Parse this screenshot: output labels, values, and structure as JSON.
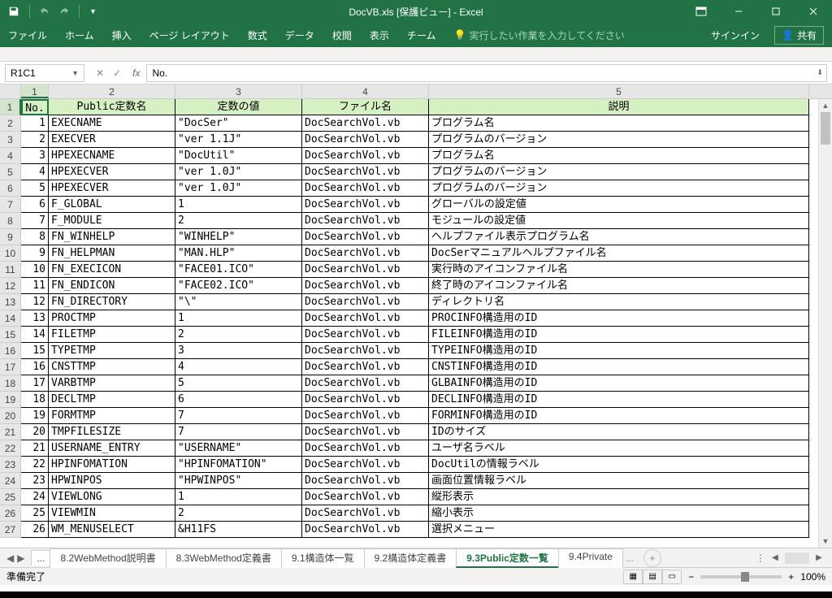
{
  "window": {
    "title": "DocVB.xls [保護ビュー] - Excel"
  },
  "ribbon": {
    "tabs": [
      "ファイル",
      "ホーム",
      "挿入",
      "ページ レイアウト",
      "数式",
      "データ",
      "校閲",
      "表示",
      "チーム"
    ],
    "tell_me": "実行したい作業を入力してください",
    "sign_in": "サインイン",
    "share": "共有"
  },
  "formula_bar": {
    "name_box": "R1C1",
    "formula": "No."
  },
  "columns": [
    "1",
    "2",
    "3",
    "4",
    "5"
  ],
  "header_row": [
    "No.",
    "Public定数名",
    "定数の値",
    "ファイル名",
    "説明"
  ],
  "rows": [
    {
      "no": "1",
      "name": "EXECNAME",
      "val": "\"DocSer\"",
      "file": "DocSearchVol.vb",
      "desc": "プログラム名"
    },
    {
      "no": "2",
      "name": "EXECVER",
      "val": "\"ver 1.1J\"",
      "file": "DocSearchVol.vb",
      "desc": "プログラムのバージョン"
    },
    {
      "no": "3",
      "name": "HPEXECNAME",
      "val": "\"DocUtil\"",
      "file": "DocSearchVol.vb",
      "desc": "プログラム名"
    },
    {
      "no": "4",
      "name": "HPEXECVER",
      "val": "\"ver 1.0J\"",
      "file": "DocSearchVol.vb",
      "desc": "プログラムのバージョン"
    },
    {
      "no": "5",
      "name": "HPEXECVER",
      "val": "\"ver 1.0J\"",
      "file": "DocSearchVol.vb",
      "desc": "プログラムのバージョン"
    },
    {
      "no": "6",
      "name": "F_GLOBAL",
      "val": "1",
      "file": "DocSearchVol.vb",
      "desc": "グローバルの設定値"
    },
    {
      "no": "7",
      "name": "F_MODULE",
      "val": "2",
      "file": "DocSearchVol.vb",
      "desc": "モジュールの設定値"
    },
    {
      "no": "8",
      "name": "FN_WINHELP",
      "val": "\"WINHELP\"",
      "file": "DocSearchVol.vb",
      "desc": "ヘルプファイル表示プログラム名"
    },
    {
      "no": "9",
      "name": "FN_HELPMAN",
      "val": "\"MAN.HLP\"",
      "file": "DocSearchVol.vb",
      "desc": "DocSerマニュアルヘルプファイル名"
    },
    {
      "no": "10",
      "name": "FN_EXECICON",
      "val": "\"FACE01.ICO\"",
      "file": "DocSearchVol.vb",
      "desc": "実行時のアイコンファイル名"
    },
    {
      "no": "11",
      "name": "FN_ENDICON",
      "val": "\"FACE02.ICO\"",
      "file": "DocSearchVol.vb",
      "desc": "終了時のアイコンファイル名"
    },
    {
      "no": "12",
      "name": "FN_DIRECTORY",
      "val": "\"\\\"",
      "file": "DocSearchVol.vb",
      "desc": "ディレクトリ名"
    },
    {
      "no": "13",
      "name": "PROCTMP",
      "val": "1",
      "file": "DocSearchVol.vb",
      "desc": "PROCINFO構造用のID"
    },
    {
      "no": "14",
      "name": "FILETMP",
      "val": "2",
      "file": "DocSearchVol.vb",
      "desc": "FILEINFO構造用のID"
    },
    {
      "no": "15",
      "name": "TYPETMP",
      "val": "3",
      "file": "DocSearchVol.vb",
      "desc": "TYPEINFO構造用のID"
    },
    {
      "no": "16",
      "name": "CNSTTMP",
      "val": "4",
      "file": "DocSearchVol.vb",
      "desc": "CNSTINFO構造用のID"
    },
    {
      "no": "17",
      "name": "VARBTMP",
      "val": "5",
      "file": "DocSearchVol.vb",
      "desc": "GLBAINFO構造用のID"
    },
    {
      "no": "18",
      "name": "DECLTMP",
      "val": "6",
      "file": "DocSearchVol.vb",
      "desc": "DECLINFO構造用のID"
    },
    {
      "no": "19",
      "name": "FORMTMP",
      "val": "7",
      "file": "DocSearchVol.vb",
      "desc": "FORMINFO構造用のID"
    },
    {
      "no": "20",
      "name": "TMPFILESIZE",
      "val": "7",
      "file": "DocSearchVol.vb",
      "desc": "IDのサイズ"
    },
    {
      "no": "21",
      "name": "USERNAME_ENTRY",
      "val": "\"USERNAME\"",
      "file": "DocSearchVol.vb",
      "desc": "ユーザ名ラベル"
    },
    {
      "no": "22",
      "name": "HPINFOMATION",
      "val": "\"HPINFOMATION\"",
      "file": "DocSearchVol.vb",
      "desc": "DocUtilの情報ラベル"
    },
    {
      "no": "23",
      "name": "HPWINPOS",
      "val": "\"HPWINPOS\"",
      "file": "DocSearchVol.vb",
      "desc": "画面位置情報ラベル"
    },
    {
      "no": "24",
      "name": "VIEWLONG",
      "val": "1",
      "file": "DocSearchVol.vb",
      "desc": "縦形表示"
    },
    {
      "no": "25",
      "name": "VIEWMIN",
      "val": "2",
      "file": "DocSearchVol.vb",
      "desc": "縮小表示"
    },
    {
      "no": "26",
      "name": "WM_MENUSELECT",
      "val": "&H11FS",
      "file": "DocSearchVol.vb",
      "desc": "選択メニュー"
    }
  ],
  "sheets": {
    "prev_ellipsis": "...",
    "tabs": [
      "8.2WebMethod説明書",
      "8.3WebMethod定義書",
      "9.1構造体一覧",
      "9.2構造体定義書",
      "9.3Public定数一覧",
      "9.4Private"
    ],
    "active_index": 4,
    "trail_ellipsis": "..."
  },
  "statusbar": {
    "ready": "準備完了",
    "zoom": "100%"
  }
}
